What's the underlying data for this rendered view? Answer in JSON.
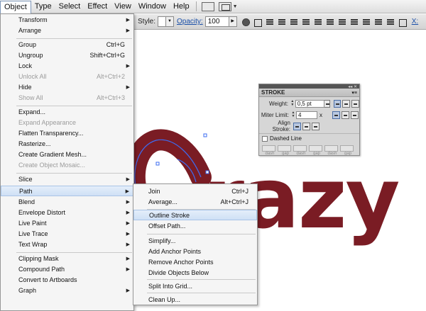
{
  "menubar": {
    "items": [
      "Object",
      "Type",
      "Select",
      "Effect",
      "View",
      "Window",
      "Help"
    ]
  },
  "controlbar": {
    "style_label": "Style:",
    "opacity_label": "Opacity:",
    "opacity_value": "100",
    "x_label": "X:"
  },
  "stroke_panel": {
    "title": "STROKE",
    "weight_label": "Weight:",
    "weight_value": "0,5 pt",
    "miter_label": "Miter Limit:",
    "miter_value": "4",
    "miter_unit": "x",
    "align_label": "Align Stroke:",
    "dashed_label": "Dashed Line",
    "dash_labels": [
      "dash",
      "gap",
      "dash",
      "gap",
      "dash",
      "gap"
    ]
  },
  "object_menu": {
    "items": [
      {
        "label": "Transform",
        "arrow": true
      },
      {
        "label": "Arrange",
        "arrow": true
      },
      {
        "label": "Group",
        "shortcut": "Ctrl+G"
      },
      {
        "label": "Ungroup",
        "shortcut": "Shift+Ctrl+G"
      },
      {
        "label": "Lock",
        "arrow": true
      },
      {
        "label": "Unlock All",
        "shortcut": "Alt+Ctrl+2",
        "disabled": true
      },
      {
        "label": "Hide",
        "arrow": true
      },
      {
        "label": "Show All",
        "shortcut": "Alt+Ctrl+3",
        "disabled": true
      },
      {
        "label": "Expand..."
      },
      {
        "label": "Expand Appearance",
        "disabled": true
      },
      {
        "label": "Flatten Transparency..."
      },
      {
        "label": "Rasterize..."
      },
      {
        "label": "Create Gradient Mesh..."
      },
      {
        "label": "Create Object Mosaic...",
        "disabled": true
      },
      {
        "label": "Slice",
        "arrow": true
      },
      {
        "label": "Path",
        "arrow": true,
        "highlighted": true
      },
      {
        "label": "Blend",
        "arrow": true
      },
      {
        "label": "Envelope Distort",
        "arrow": true
      },
      {
        "label": "Live Paint",
        "arrow": true
      },
      {
        "label": "Live Trace",
        "arrow": true
      },
      {
        "label": "Text Wrap",
        "arrow": true
      },
      {
        "label": "Clipping Mask",
        "arrow": true
      },
      {
        "label": "Compound Path",
        "arrow": true
      },
      {
        "label": "Convert to Artboards"
      },
      {
        "label": "Graph",
        "arrow": true
      }
    ]
  },
  "path_menu": {
    "items": [
      {
        "label": "Join",
        "shortcut": "Ctrl+J"
      },
      {
        "label": "Average...",
        "shortcut": "Alt+Ctrl+J"
      },
      {
        "label": "Outline Stroke",
        "highlighted": true
      },
      {
        "label": "Offset Path..."
      },
      {
        "label": "Simplify..."
      },
      {
        "label": "Add Anchor Points"
      },
      {
        "label": "Remove Anchor Points"
      },
      {
        "label": "Divide Objects Below"
      },
      {
        "label": "Split Into Grid..."
      },
      {
        "label": "Clean Up..."
      }
    ]
  },
  "artwork": {
    "text": "razy",
    "fill_color": "#7a1c24",
    "selection_color": "#3d6cf2"
  }
}
